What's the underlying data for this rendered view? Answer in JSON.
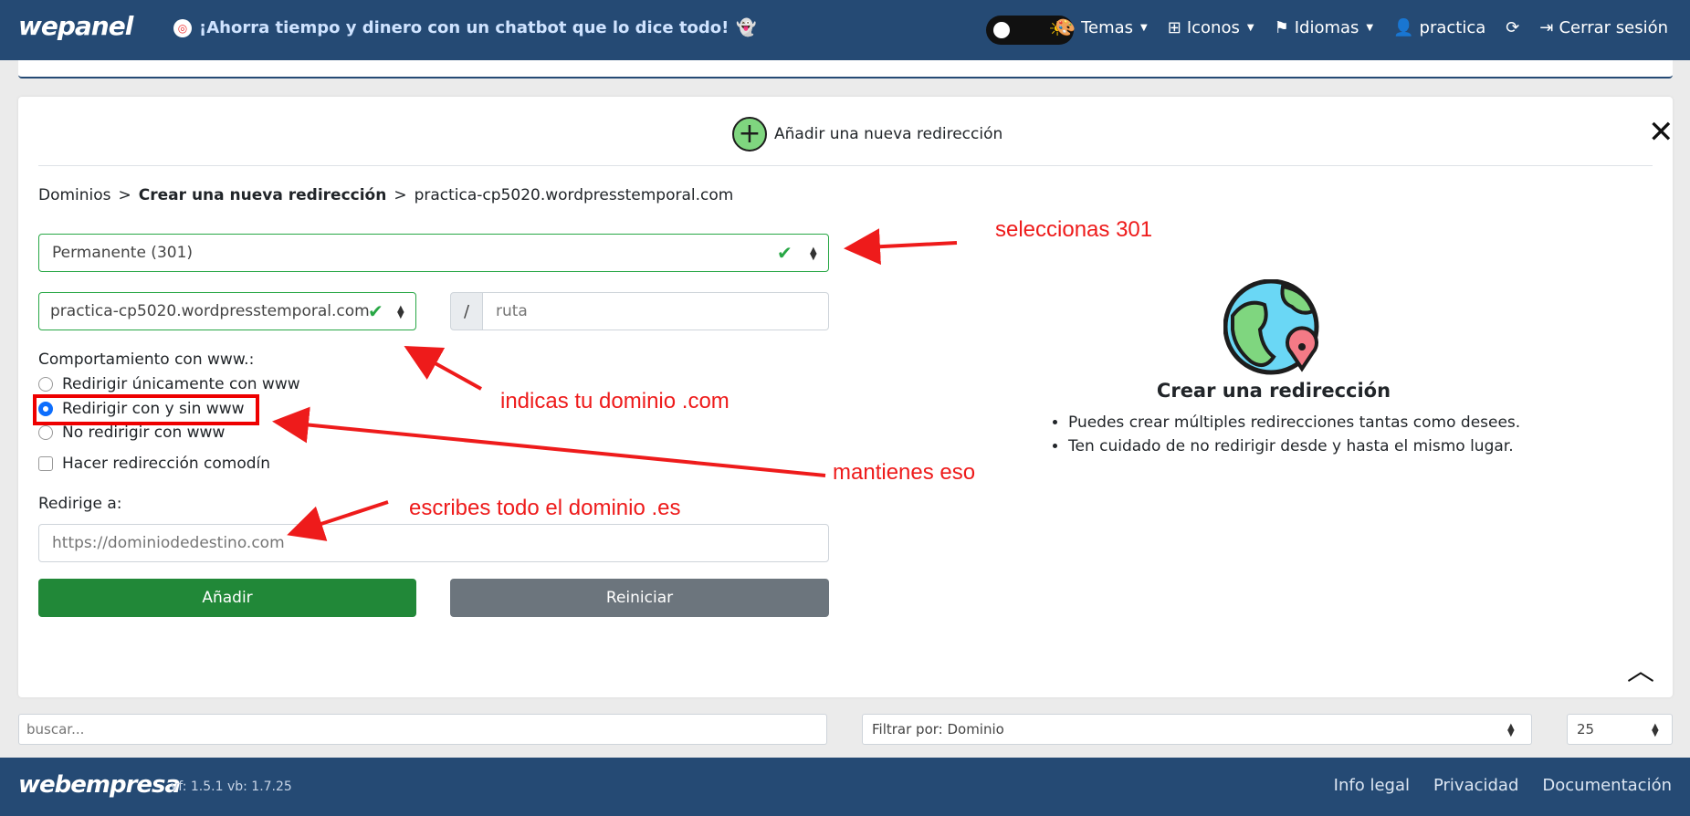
{
  "navbar": {
    "logo": "wepanel",
    "promo_text": "¡Ahorra tiempo y dinero con un chatbot que lo dice todo!",
    "items": [
      {
        "label": "Temas",
        "icon": "palette-icon",
        "dropdown": true
      },
      {
        "label": "Iconos",
        "icon": "icons-icon",
        "dropdown": true
      },
      {
        "label": "Idiomas",
        "icon": "flag-icon",
        "dropdown": true
      },
      {
        "label": "practica",
        "icon": "user-gear-icon",
        "dropdown": false
      },
      {
        "label": "",
        "icon": "refresh-icon",
        "dropdown": false
      },
      {
        "label": "Cerrar sesión",
        "icon": "logout-icon",
        "dropdown": false
      }
    ]
  },
  "card": {
    "title": "Añadir una nueva redirección",
    "breadcrumb": {
      "root": "Dominios",
      "current": "Crear una nueva redirección",
      "domain": "practica-cp5020.wordpresstemporal.com"
    },
    "redirect_type": "Permanente (301)",
    "source_domain": "practica-cp5020.wordpresstemporal.com",
    "path_prefix": "/",
    "path_placeholder": "ruta",
    "www_label": "Comportamiento con www.:",
    "www_options": [
      {
        "label": "Redirigir únicamente con www",
        "selected": false
      },
      {
        "label": "Redirigir con y sin www",
        "selected": true
      },
      {
        "label": "No redirigir con www",
        "selected": false
      }
    ],
    "wildcard_label": "Hacer redirección comodín",
    "redirect_to_label": "Redirige a:",
    "redirect_to_placeholder": "https://dominiodedestino.com",
    "add_button": "Añadir",
    "reset_button": "Reiniciar"
  },
  "info": {
    "title": "Crear una redirección",
    "bullets": [
      "Puedes crear múltiples redirecciones tantas como desees.",
      "Ten cuidado de no redirigir desde y hasta el mismo lugar."
    ]
  },
  "annotations": {
    "select_301": "seleccionas 301",
    "domain_com": "indicas tu dominio .com",
    "keep_that": "mantienes eso",
    "write_es": "escribes todo el dominio .es",
    "color": "#ee1b1b"
  },
  "filters": {
    "search_placeholder": "buscar...",
    "filter_by": "Filtrar por: Dominio",
    "per_page": "25"
  },
  "footer": {
    "logo": "webempresa",
    "version": "vf: 1.5.1 vb: 1.7.25",
    "links": [
      "Info legal",
      "Privacidad",
      "Documentación"
    ]
  },
  "colors": {
    "navbar_bg": "#254a74",
    "success": "#218838",
    "secondary": "#6c757d",
    "annotation": "#ee1b1b"
  }
}
